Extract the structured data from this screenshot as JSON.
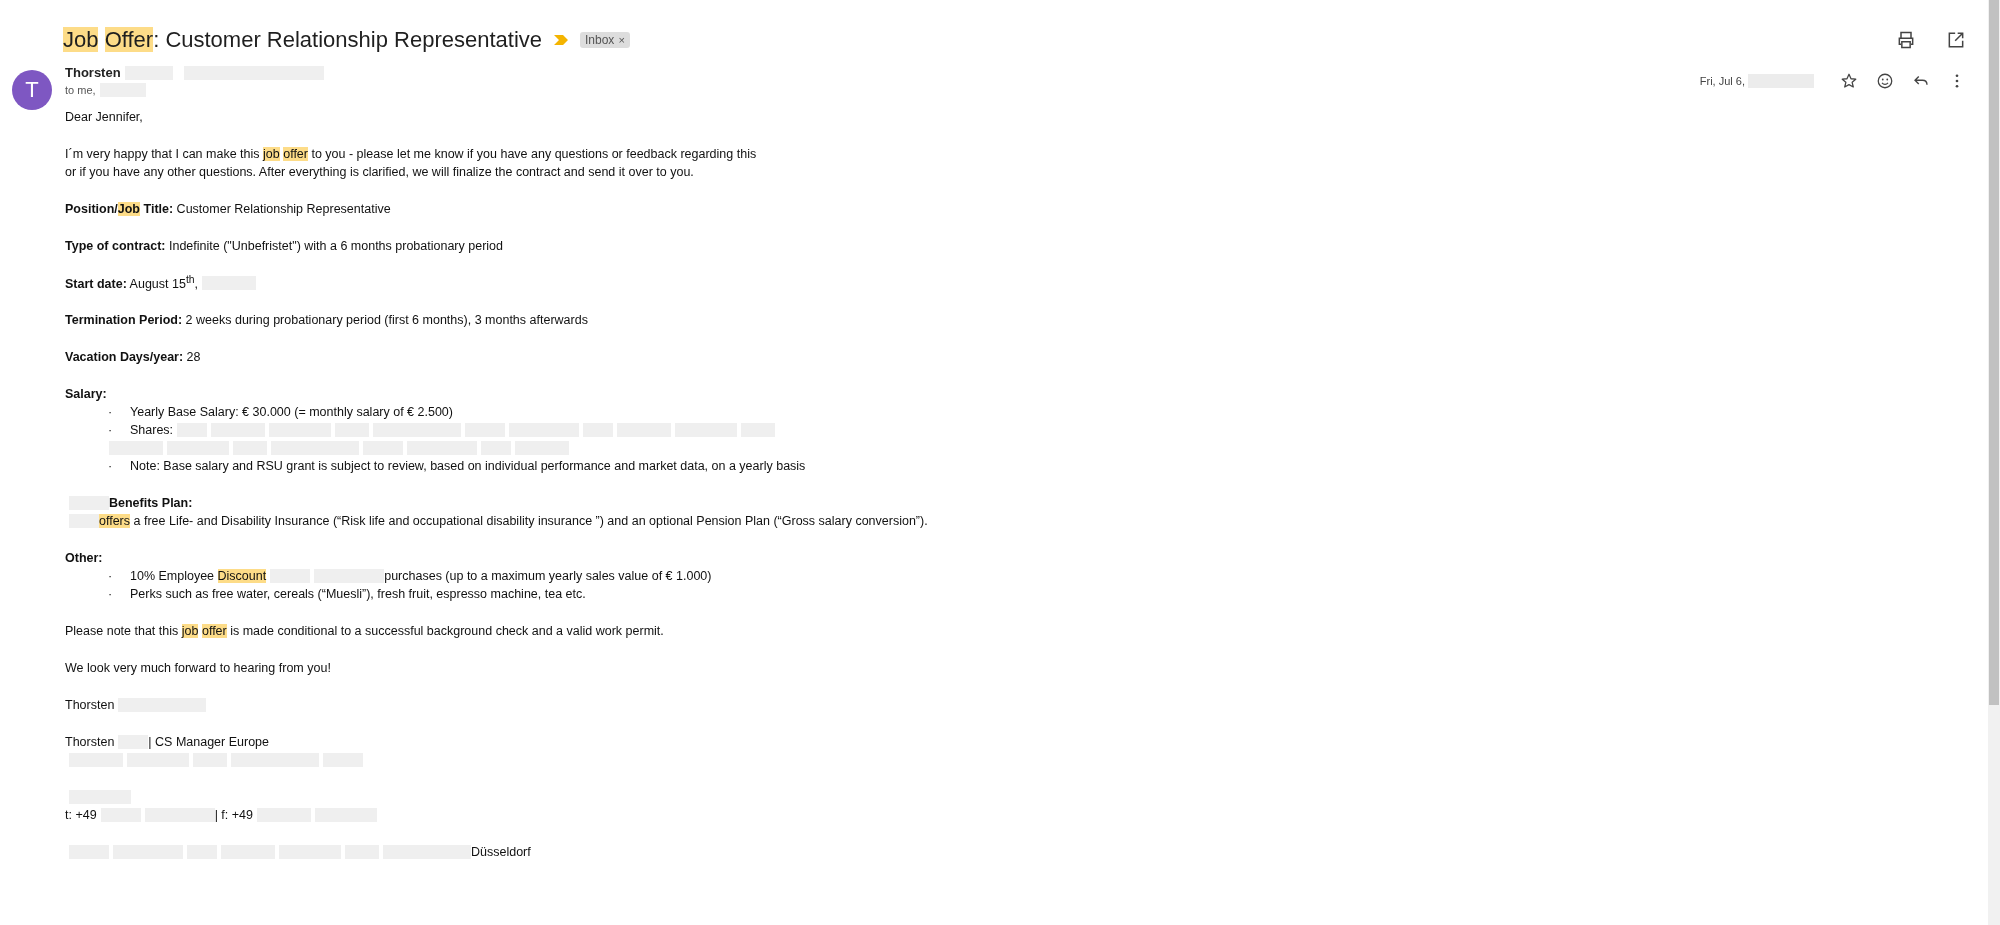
{
  "subject": {
    "segments": [
      {
        "text": "Job",
        "highlight": true
      },
      {
        "text": "Offer",
        "highlight": true
      },
      {
        "text": ": Customer Relationship Representative",
        "highlight": false
      }
    ]
  },
  "label": {
    "text": "Inbox",
    "close": "×"
  },
  "sender": {
    "initial": "T",
    "name": "Thorsten",
    "to": "to me,"
  },
  "date": "Fri, Jul 6,",
  "blocks": [
    {
      "lines": [
        {
          "kind": "text",
          "segments": [
            {
              "kind": "text",
              "text": "Dear Jennifer,",
              "highlight": false
            }
          ]
        }
      ]
    },
    {
      "lines": [
        {
          "kind": "text",
          "segments": [
            {
              "kind": "text",
              "text": "I´m very happy that I can make this ",
              "highlight": false
            },
            {
              "kind": "text",
              "text": "job",
              "highlight": true
            },
            {
              "kind": "text",
              "text": "offer",
              "highlight": true
            },
            {
              "kind": "text",
              "text": " to you - please let me know if you have any questions or feedback regarding this",
              "highlight": false
            }
          ]
        },
        {
          "kind": "text",
          "segments": [
            {
              "kind": "text",
              "text": "or if you have any other questions. After everything is clarified, we will finalize the contract and send it over to you.",
              "highlight": false
            }
          ]
        }
      ]
    },
    {
      "lines": [
        {
          "kind": "text",
          "segments": [
            {
              "kind": "text",
              "text": "**Position/**",
              "highlight": false
            },
            {
              "kind": "text",
              "text": "**Job**",
              "highlight": true
            },
            {
              "kind": "text",
              "text": " **Title:** Customer Relationship Representative",
              "highlight": false
            }
          ]
        }
      ]
    },
    {
      "lines": [
        {
          "kind": "text",
          "segments": [
            {
              "kind": "text",
              "text": "**Type of contract:** Indefinite (\"Unbefristet\") with a 6 months probationary period",
              "highlight": false
            }
          ]
        }
      ]
    },
    {
      "lines": [
        {
          "kind": "text",
          "segments": [
            {
              "kind": "text",
              "text": "**Start date:** August 15$^{th}$,",
              "highlight": false
            },
            {
              "kind": "redaction"
            }
          ]
        }
      ]
    },
    {
      "lines": [
        {
          "kind": "text",
          "segments": [
            {
              "kind": "text",
              "text": "**Termination Period:** 2 weeks during probationary period (first 6 months), 3 months afterwards",
              "highlight": false
            }
          ]
        }
      ]
    },
    {
      "lines": [
        {
          "kind": "text",
          "segments": [
            {
              "kind": "text",
              "text": "**Vacation Days/year:** 28",
              "highlight": false
            }
          ]
        }
      ]
    },
    {
      "lines": [
        {
          "kind": "text",
          "segments": [
            {
              "kind": "text",
              "text": "**Salary:**",
              "highlight": false
            }
          ]
        },
        {
          "kind": "bullet",
          "marker": "·",
          "segments": [
            {
              "kind": "text",
              "text": "Yearly Base Salary: € 30.000 (= monthly salary of € 2.500)",
              "highlight": false
            }
          ]
        },
        {
          "kind": "bullet",
          "marker": "·",
          "segments": [
            {
              "kind": "text",
              "text": "Shares:",
              "highlight": false
            },
            {
              "kind": "redaction"
            },
            {
              "kind": "redaction"
            },
            {
              "kind": "redaction"
            },
            {
              "kind": "redaction"
            },
            {
              "kind": "redaction"
            },
            {
              "kind": "redaction"
            },
            {
              "kind": "redaction"
            },
            {
              "kind": "redaction"
            },
            {
              "kind": "redaction"
            },
            {
              "kind": "redaction"
            },
            {
              "kind": "redaction"
            }
          ]
        },
        {
          "kind": "continuation",
          "segments": [
            {
              "kind": "redaction"
            },
            {
              "kind": "redaction"
            },
            {
              "kind": "redaction"
            },
            {
              "kind": "redaction"
            },
            {
              "kind": "redaction"
            },
            {
              "kind": "redaction"
            },
            {
              "kind": "redaction"
            },
            {
              "kind": "redaction"
            }
          ]
        },
        {
          "kind": "bullet",
          "marker": "·",
          "segments": [
            {
              "kind": "text",
              "text": "Note: Base salary and RSU grant is subject to review, based on individual performance and market data, on a yearly basis",
              "highlight": false
            }
          ]
        }
      ]
    },
    {
      "lines": [
        {
          "kind": "text",
          "segments": [
            {
              "kind": "redaction"
            },
            {
              "kind": "text",
              "text": "**Benefits Plan:**",
              "highlight": false
            }
          ]
        },
        {
          "kind": "text",
          "segments": [
            {
              "kind": "redaction"
            },
            {
              "kind": "text",
              "text": "offers",
              "highlight": true
            },
            {
              "kind": "text",
              "text": " a free Life- and Disability Insurance (“Risk life and occupational disability insurance ”) and an optional Pension Plan (“Gross salary conversion”).",
              "highlight": false
            }
          ]
        }
      ]
    },
    {
      "lines": [
        {
          "kind": "text",
          "segments": [
            {
              "kind": "text",
              "text": "**Other:**",
              "highlight": false
            }
          ]
        },
        {
          "kind": "bullet",
          "marker": "·",
          "segments": [
            {
              "kind": "text",
              "text": "10% Employee ",
              "highlight": false
            },
            {
              "kind": "text",
              "text": "Discount",
              "highlight": true
            },
            {
              "kind": "redaction"
            },
            {
              "kind": "redaction"
            },
            {
              "kind": "text",
              "text": "purchases (up to a maximum yearly sales value of € 1.000)",
              "highlight": false
            }
          ]
        },
        {
          "kind": "bullet",
          "marker": "·",
          "segments": [
            {
              "kind": "text",
              "text": "Perks such as free water, cereals (“Muesli”), fresh fruit, espresso machine, tea etc.",
              "highlight": false
            }
          ]
        }
      ]
    },
    {
      "lines": [
        {
          "kind": "text",
          "segments": [
            {
              "kind": "text",
              "text": "Please note that this ",
              "highlight": false
            },
            {
              "kind": "text",
              "text": "job",
              "highlight": true
            },
            {
              "kind": "text",
              "text": "offer",
              "highlight": true
            },
            {
              "kind": "text",
              "text": " is made conditional to a successful background check and a valid work permit.",
              "highlight": false
            }
          ]
        }
      ]
    },
    {
      "lines": [
        {
          "kind": "text",
          "segments": [
            {
              "kind": "text",
              "text": "We look very much forward to hearing from you!",
              "highlight": false
            }
          ]
        }
      ]
    },
    {
      "lines": [
        {
          "kind": "text",
          "segments": [
            {
              "kind": "text",
              "text": "Thorsten",
              "highlight": false
            },
            {
              "kind": "redaction"
            }
          ]
        }
      ]
    },
    {
      "lines": [
        {
          "kind": "text",
          "segments": [
            {
              "kind": "text",
              "text": "Thorsten",
              "highlight": false
            },
            {
              "kind": "redaction"
            },
            {
              "kind": "text",
              "text": "| CS Manager Europe",
              "highlight": false
            }
          ]
        },
        {
          "kind": "text",
          "segments": [
            {
              "kind": "redaction"
            },
            {
              "kind": "redaction"
            },
            {
              "kind": "redaction"
            },
            {
              "kind": "redaction"
            },
            {
              "kind": "redaction"
            }
          ]
        }
      ]
    },
    {
      "lines": [
        {
          "kind": "text",
          "segments": [
            {
              "kind": "redaction"
            }
          ]
        },
        {
          "kind": "text",
          "segments": [
            {
              "kind": "text",
              "text": "t: +49",
              "highlight": false
            },
            {
              "kind": "redaction"
            },
            {
              "kind": "redaction"
            },
            {
              "kind": "text",
              "text": "| f: +49",
              "highlight": false
            },
            {
              "kind": "redaction"
            },
            {
              "kind": "redaction"
            }
          ]
        }
      ]
    },
    {
      "lines": [
        {
          "kind": "text",
          "segments": [
            {
              "kind": "redaction"
            },
            {
              "kind": "redaction"
            },
            {
              "kind": "redaction"
            },
            {
              "kind": "redaction"
            },
            {
              "kind": "redaction"
            },
            {
              "kind": "redaction"
            },
            {
              "kind": "redaction"
            },
            {
              "kind": "text",
              "text": "Düsseldorf",
              "highlight": false
            }
          ]
        }
      ]
    }
  ]
}
